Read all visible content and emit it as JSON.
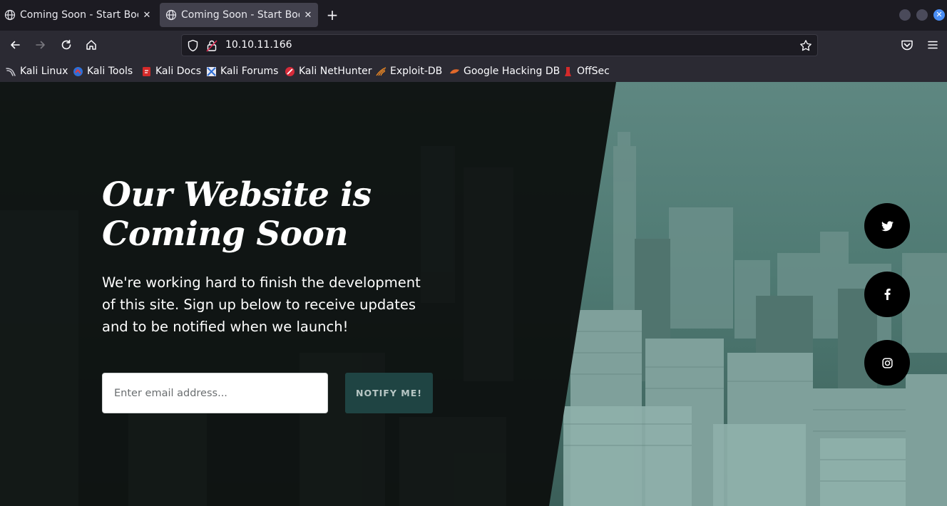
{
  "browser": {
    "tabs": [
      {
        "title": "Coming Soon - Start Bootstrap Theme",
        "active": false
      },
      {
        "title": "Coming Soon - Start Bootstrap Theme",
        "active": true
      }
    ],
    "url": "10.10.11.166",
    "bookmarks": [
      {
        "label": "Kali Linux",
        "icon": "kali-dragon-icon"
      },
      {
        "label": "Kali Tools",
        "icon": "kali-tools-icon"
      },
      {
        "label": "Kali Docs",
        "icon": "kali-docs-icon"
      },
      {
        "label": "Kali Forums",
        "icon": "kali-forums-icon"
      },
      {
        "label": "Kali NetHunter",
        "icon": "nethunter-icon"
      },
      {
        "label": "Exploit-DB",
        "icon": "exploit-db-icon"
      },
      {
        "label": "Google Hacking DB",
        "icon": "ghdb-icon"
      },
      {
        "label": "OffSec",
        "icon": "offsec-icon"
      }
    ]
  },
  "page": {
    "headline": "Our Website is Coming Soon",
    "lead": "We're working hard to finish the development of this site. Sign up below to receive updates and to be notified when we launch!",
    "email_placeholder": "Enter email address...",
    "notify_label": "NOTIFY ME!",
    "social": [
      {
        "name": "twitter-icon",
        "glyph": "twitter"
      },
      {
        "name": "facebook-icon",
        "glyph": "f"
      },
      {
        "name": "instagram-icon",
        "glyph": "instagram"
      }
    ]
  },
  "colors": {
    "accent": "#1f4443",
    "teal_overlay": "#5d8a84",
    "dark_panel": "#0d0f0f",
    "url_bar": "#1c1b22"
  }
}
